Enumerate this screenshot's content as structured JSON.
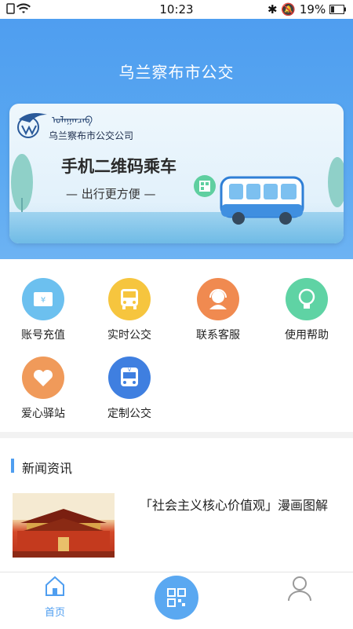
{
  "status_bar": {
    "time": "10:23",
    "battery": "19%"
  },
  "header": {
    "title": "乌兰察布市公交"
  },
  "banner": {
    "company": "乌兰察布市公交公司",
    "slogan": "手机二维码乘车",
    "subslogan": "— 出行更方便 —"
  },
  "functions": [
    {
      "label": "账号充值",
      "icon": "wallet-icon",
      "color": "#6cc0ef"
    },
    {
      "label": "实时公交",
      "icon": "bus-icon",
      "color": "#f6c53e"
    },
    {
      "label": "联系客服",
      "icon": "headset-icon",
      "color": "#f08a50"
    },
    {
      "label": "使用帮助",
      "icon": "lightbulb-icon",
      "color": "#5fd3a4"
    },
    {
      "label": "爱心驿站",
      "icon": "heart-icon",
      "color": "#f09a5a"
    },
    {
      "label": "定制公交",
      "icon": "custom-bus-icon",
      "color": "#3f7fe0"
    }
  ],
  "news": {
    "section_title": "新闻资讯",
    "items": [
      {
        "headline": "「社会主义核心价值观」漫画图解"
      }
    ]
  },
  "tabbar": {
    "home_label": "首页"
  },
  "colors": {
    "primary": "#4f9ef0"
  }
}
